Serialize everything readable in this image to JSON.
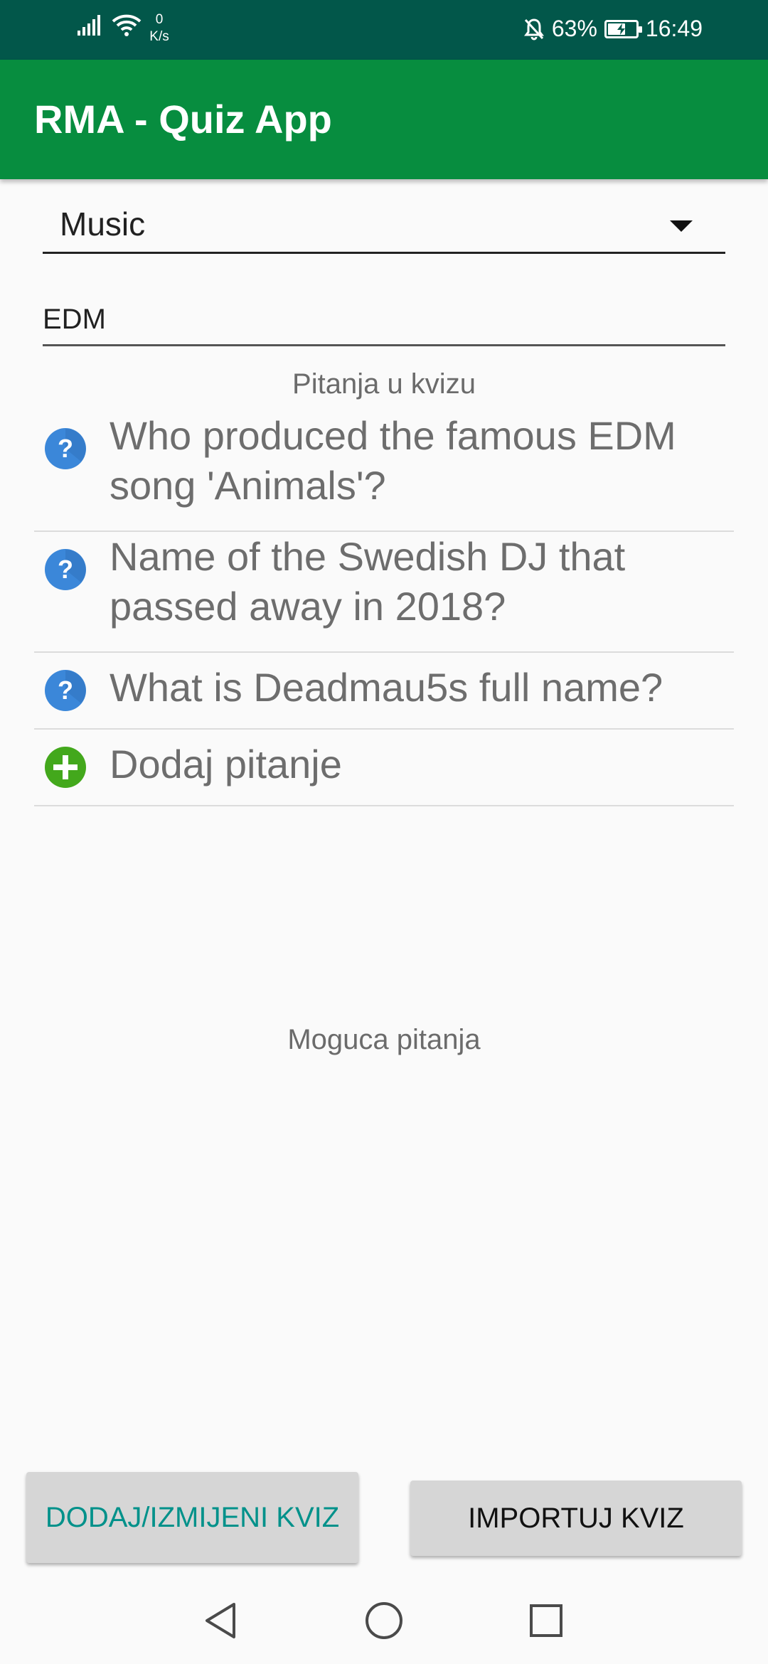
{
  "status_bar": {
    "net_speed_value": "0",
    "net_speed_unit": "K/s",
    "battery_percent": "63%",
    "battery_level": 0.63,
    "time": "16:49",
    "icons": [
      "signal-icon",
      "wifi-icon",
      "bell-off-icon",
      "battery-charging-icon"
    ]
  },
  "app_bar": {
    "title": "RMA - Quiz App",
    "color": "#078d3f"
  },
  "category_spinner": {
    "selected": "Music"
  },
  "quiz_name": {
    "value": "EDM"
  },
  "sections": {
    "quiz_questions_label": "Pitanja u kvizu",
    "possible_questions_label": "Moguca pitanja"
  },
  "quiz_questions": [
    {
      "text": "Who produced the famous EDM song 'Animals'?",
      "icon": "question-icon"
    },
    {
      "text": "Name of the Swedish DJ that passed away in 2018?",
      "icon": "question-icon"
    },
    {
      "text": "What is Deadmau5s full name?",
      "icon": "question-icon"
    }
  ],
  "add_question": {
    "label": "Dodaj pitanje",
    "icon": "add-icon"
  },
  "buttons": {
    "add_edit_quiz": "DODAJ/IZMIJENI KVIZ",
    "import_quiz": "IMPORTUJ KVIZ"
  },
  "nav_bar": {
    "icons": [
      "back-icon",
      "home-icon",
      "recents-icon"
    ]
  },
  "colors": {
    "status_bar": "#02574a",
    "app_bar": "#078d3f",
    "question_icon": "#3b87d9",
    "add_icon": "#43a81c",
    "add_edit_text": "#00918a"
  }
}
